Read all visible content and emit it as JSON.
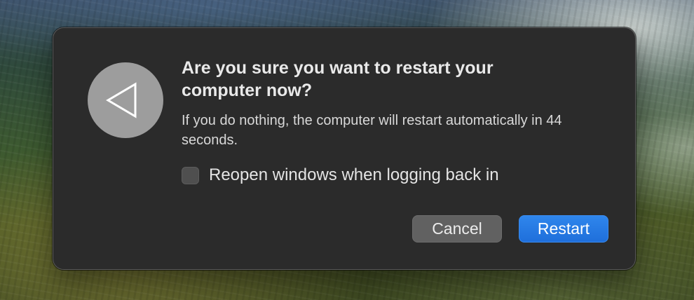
{
  "dialog": {
    "icon": "restart-triangle-icon",
    "title": "Are you sure you want to restart your computer now?",
    "message": "If you do nothing, the computer will restart automatically in 44 seconds.",
    "checkbox": {
      "label": "Reopen windows when logging back in",
      "checked": false
    },
    "buttons": {
      "cancel_label": "Cancel",
      "restart_label": "Restart"
    }
  },
  "colors": {
    "dialog_background": "#2b2b2b",
    "primary_button": "#1f6fdb",
    "secondary_button": "#616161",
    "icon_circle": "#9d9d9d"
  }
}
